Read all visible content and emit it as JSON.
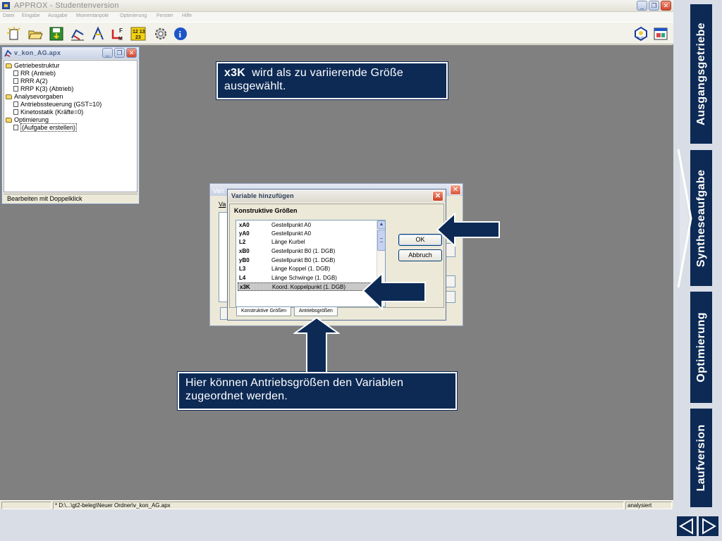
{
  "app": {
    "title": "APPROX - Studentenversion",
    "menu": [
      "Datei",
      "Eingabe",
      "Ausgabe",
      "Momentanpole",
      "Optimierung",
      "Fenster",
      "Hilfe"
    ]
  },
  "toolbar": {
    "icons": [
      "new-document-icon",
      "open-folder-icon",
      "save-icon",
      "mechanism-icon",
      "linkage-icon",
      "force-icon",
      "calculation-icon",
      "gear-icon",
      "info-icon",
      "tu-dresden-logo-icon",
      "window-icon"
    ],
    "calc_label_top": "12 13",
    "calc_label_bottom": "23"
  },
  "tree_window": {
    "title": "v_kon_AG.apx",
    "items": [
      {
        "label": "Getriebestruktur",
        "kind": "folder",
        "level": 0
      },
      {
        "label": "RR (Antrieb)",
        "kind": "doc",
        "level": 1
      },
      {
        "label": "RRR A(2)",
        "kind": "doc",
        "level": 1
      },
      {
        "label": "RRP K(3) (Abtrieb)",
        "kind": "doc",
        "level": 1
      },
      {
        "label": "Analysevorgaben",
        "kind": "folder",
        "level": 0
      },
      {
        "label": "Antriebssteuerung (GST=10)",
        "kind": "doc",
        "level": 1
      },
      {
        "label": "Kinetostatik (Kräfte=0)",
        "kind": "doc",
        "level": 1
      },
      {
        "label": "Optimierung",
        "kind": "folder",
        "level": 0
      },
      {
        "label": "(Aufgabe erstellen)",
        "kind": "doc",
        "level": 1
      }
    ],
    "status": "Bearbeiten mit Doppelklick"
  },
  "back_dialog": {
    "title_fragment": "Vari",
    "label_fragment": "Va"
  },
  "dialog": {
    "title": "Variable hinzufügen",
    "group_label": "Konstruktive Größen",
    "rows": [
      {
        "code": "xA0",
        "desc": "Gestellpunkt A0"
      },
      {
        "code": "yA0",
        "desc": "Gestellpunkt A0"
      },
      {
        "code": "L2",
        "desc": "Länge Kurbel"
      },
      {
        "code": "xB0",
        "desc": "Gestellpunkt B0 (1. DGB)"
      },
      {
        "code": "yB0",
        "desc": "Gestellpunkt B0 (1. DGB)"
      },
      {
        "code": "L3",
        "desc": "Länge Koppel (1. DGB)"
      },
      {
        "code": "L4",
        "desc": "Länge Schwinge (1. DGB)"
      },
      {
        "code": "x3K",
        "desc": "Koord. Koppelpunkt (1. DGB)"
      }
    ],
    "selected_index": 7,
    "ok_label": "OK",
    "cancel_label": "Abbruch",
    "tabs": [
      "Konstruktive Größen",
      "Antriebsgrößen"
    ]
  },
  "statusbar": {
    "path": "* D:\\...\\gt2-beleg\\Neuer Ordner\\v_kon_AG.apx",
    "state": "analysiert"
  },
  "callouts": {
    "top_bold": "x3K",
    "top_text": "wird als zu variierende Größe ausgewählt.",
    "bottom_text": "Hier können Antriebsgrößen den Variablen zugeordnet werden."
  },
  "nav": {
    "tabs": [
      "Ausgangsgetriebe",
      "Syntheseaufgabe",
      "Optimierung",
      "Laufversion"
    ],
    "active": "Syntheseaufgabe"
  },
  "colors": {
    "accent": "#0d2a55",
    "desktop": "#808080",
    "window_bg": "#ece9d8"
  }
}
